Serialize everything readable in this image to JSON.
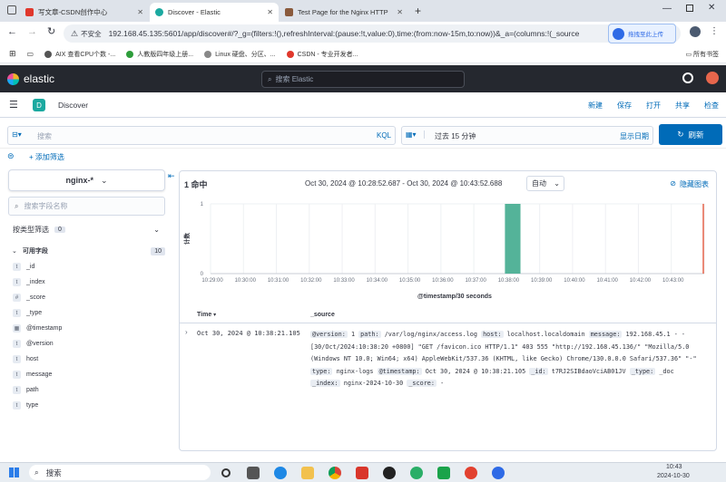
{
  "browser": {
    "tabs": [
      {
        "title": "写文章-CSDN创作中心",
        "color": "#e0382c"
      },
      {
        "title": "Discover - Elastic",
        "color": "#1ba9a0"
      },
      {
        "title": "Test Page for the Nginx HTTP",
        "color": "#8a5a3c"
      }
    ],
    "new_tab": "+",
    "not_secure": "不安全",
    "url": "192.168.45.135:5601/app/discover#/?_g=(filters:!(),refreshInterval:(pause:!t,value:0),time:(from:now-15m,to:now))&_a=(columns:!(_source",
    "baidu_upload": "拖拽至此上传",
    "bookmarks": [
      {
        "label": "AIX 查看CPU个数 -...",
        "color": "#555"
      },
      {
        "label": "人教版四年级上册...",
        "color": "#2e9d3b"
      },
      {
        "label": "Linux 硬盘、分区、...",
        "color": "#888"
      },
      {
        "label": "CSDN - 专业开发者...",
        "color": "#e0382c"
      }
    ],
    "all_bookmarks": "所有书签"
  },
  "kibana": {
    "brand": "elastic",
    "search_placeholder": "搜索 Elastic",
    "app_badge": "D",
    "app_title": "Discover",
    "actions": [
      "新建",
      "保存",
      "打开",
      "共享",
      "检查"
    ],
    "query_placeholder": "搜索",
    "kql": "KQL",
    "time_range": "过去 15 分钟",
    "show_dates": "显示日期",
    "refresh": "刷新",
    "add_filter": "+ 添加筛选",
    "index_pattern": "nginx-*",
    "field_search_placeholder": "搜索字段名称",
    "filter_by_type": "按类型筛选",
    "filter_count": "0",
    "available_fields": "可用字段",
    "available_count": "10",
    "fields": [
      {
        "type": "t",
        "name": "_id"
      },
      {
        "type": "t",
        "name": "_index"
      },
      {
        "type": "#",
        "name": "_score"
      },
      {
        "type": "t",
        "name": "_type"
      },
      {
        "type": "cal",
        "name": "@timestamp"
      },
      {
        "type": "t",
        "name": "@version"
      },
      {
        "type": "t",
        "name": "host"
      },
      {
        "type": "t",
        "name": "message"
      },
      {
        "type": "t",
        "name": "path"
      },
      {
        "type": "t",
        "name": "type"
      }
    ],
    "hits": "1 命中",
    "range_text": "Oct 30, 2024 @ 10:28:52.687 - Oct 30, 2024 @ 10:43:52.688",
    "interval": "自动",
    "hide_chart": "隐藏图表",
    "col_time": "Time",
    "col_source": "_source",
    "row": {
      "time": "Oct 30, 2024 @ 10:38:21.105",
      "version_label": "@version:",
      "version": "1",
      "path_label": "path:",
      "path": "/var/log/nginx/access.log",
      "host_label": "host:",
      "host": "localhost.localdomain",
      "message_label": "message:",
      "message": "192.168.45.1 - - [30/Oct/2024:10:38:20 +0800] \"GET /favicon.ico HTTP/1.1\" 403 555 \"http://192.168.45.136/\" \"Mozilla/5.0 (Windows NT 10.0; Win64; x64) AppleWebKit/537.36 (KHTML, like Gecko) Chrome/130.0.0.0 Safari/537.36\" \"-\"",
      "type_label": "type:",
      "type": "nginx-logs",
      "ts_label": "@timestamp:",
      "ts": "Oct 30, 2024 @ 10:38:21.105",
      "id_label": "_id:",
      "id": "t7RJ2SIBdaoVciAB01JV",
      "dtype_label": "_type:",
      "dtype": "_doc",
      "index_label": "_index:",
      "index": "nginx-2024-10-30",
      "score_label": "_score:",
      "score": "-"
    }
  },
  "chart_data": {
    "type": "bar",
    "xlabel": "@timestamp/30 seconds",
    "ylabel": "计数",
    "ylim": [
      0,
      1
    ],
    "yticks": [
      "0",
      "1"
    ],
    "xticks": [
      "10:29:00",
      "10:30:00",
      "10:31:00",
      "10:32:00",
      "10:33:00",
      "10:34:00",
      "10:35:00",
      "10:36:00",
      "10:37:00",
      "10:38:00",
      "10:39:00",
      "10:40:00",
      "10:41:00",
      "10:42:00",
      "10:43:00"
    ],
    "bars": [
      {
        "x": "10:38:00",
        "value": 1
      }
    ],
    "color": "#54b399"
  },
  "taskbar": {
    "search": "搜索",
    "time": "10:43",
    "date": "2024-10-30"
  }
}
